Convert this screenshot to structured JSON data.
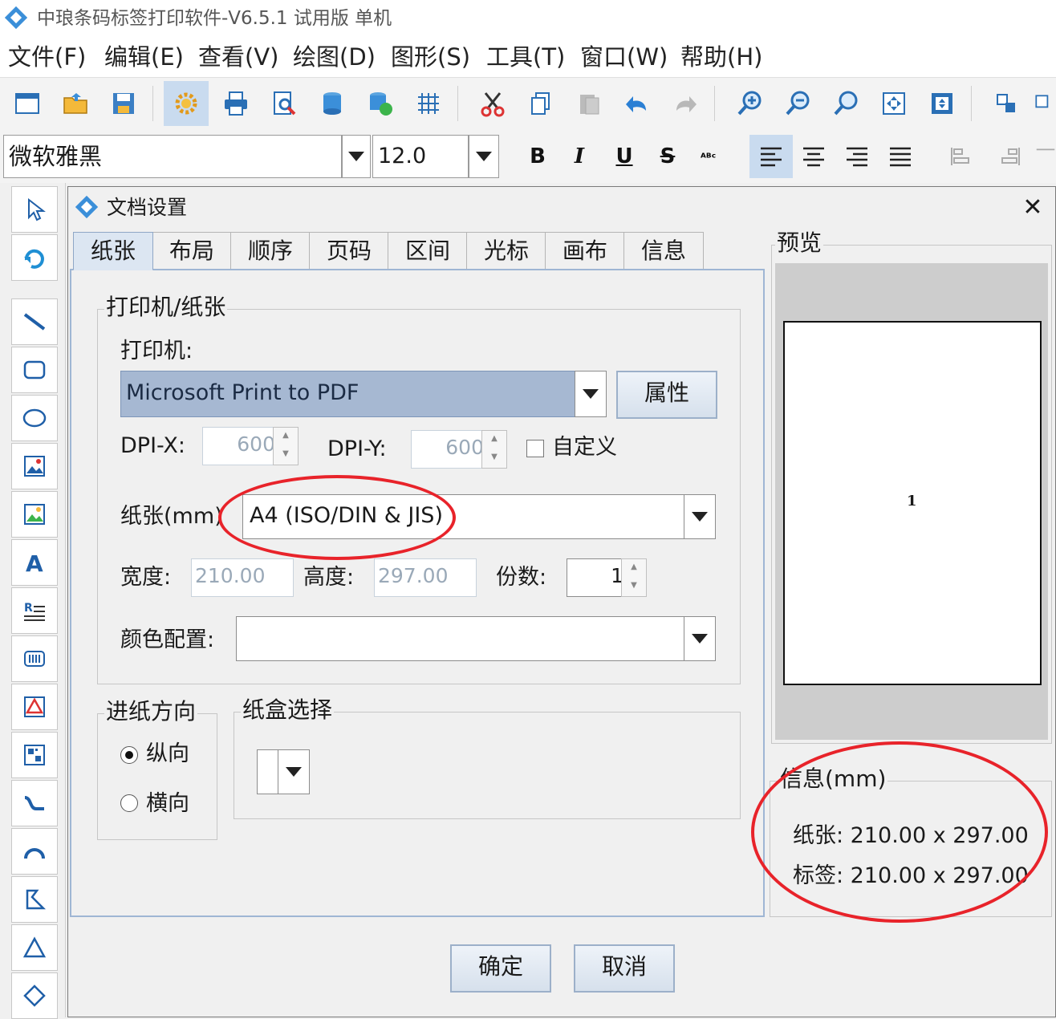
{
  "app": {
    "title": "中琅条码标签打印软件-V6.5.1 试用版 单机"
  },
  "menu": [
    "文件(F)",
    "编辑(E)",
    "查看(V)",
    "绘图(D)",
    "图形(S)",
    "工具(T)",
    "窗口(W)",
    "帮助(H)"
  ],
  "font_toolbar": {
    "font": "微软雅黑",
    "size": "12.0",
    "bold": "B",
    "italic": "I",
    "underline": "U",
    "strike": "S"
  },
  "dialog": {
    "title": "文档设置",
    "close": "✕",
    "tabs": [
      "纸张",
      "布局",
      "顺序",
      "页码",
      "区间",
      "光标",
      "画布",
      "信息"
    ],
    "printer_group": "打印机/纸张",
    "printer_label": "打印机:",
    "printer_value": "Microsoft Print to PDF",
    "properties_button": "属性",
    "dpi_x_label": "DPI-X:",
    "dpi_x_value": "600",
    "dpi_y_label": "DPI-Y:",
    "dpi_y_value": "600",
    "custom_label": "自定义",
    "paper_label": "纸张(mm)",
    "paper_value": "A4 (ISO/DIN & JIS)",
    "width_label": "宽度:",
    "width_value": "210.00",
    "height_label": "高度:",
    "height_value": "297.00",
    "copies_label": "份数:",
    "copies_value": "1",
    "color_label": "颜色配置:",
    "color_value": "",
    "feed_group": "进纸方向",
    "portrait": "纵向",
    "landscape": "横向",
    "tray_group": "纸盒选择",
    "preview_group": "预览",
    "preview_page": "1",
    "info_group": "信息(mm)",
    "info_paper": "纸张: 210.00 x 297.00",
    "info_label": "标签: 210.00 x 297.00",
    "ok_button": "确定",
    "cancel_button": "取消"
  },
  "colors": {
    "accent": "#a6b8d2",
    "annotation": "#e8232a"
  }
}
